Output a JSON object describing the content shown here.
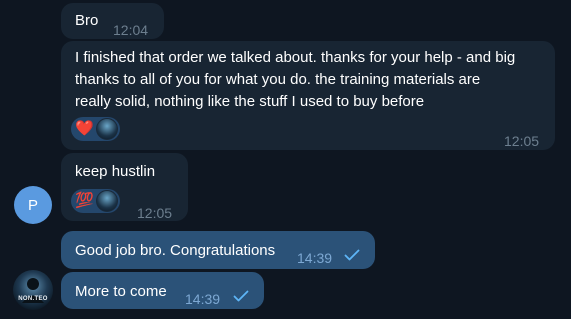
{
  "messages": [
    {
      "text": "Bro",
      "time": "12:04"
    },
    {
      "lines": [
        "I finished that order we talked about. thanks for your help - and big",
        "thanks to all of you for what you do. the training materials are",
        "really solid, nothing like the stuff I used to buy before"
      ],
      "time": "12:05",
      "reactions": [
        {
          "emoji": "❤️"
        }
      ]
    },
    {
      "text": "keep hustlin",
      "time": "12:05",
      "reactions": [
        {
          "emoji": "💯"
        }
      ]
    },
    {
      "text": "Good job bro. Congratulations",
      "time": "14:39",
      "status": "sent"
    },
    {
      "text": "More to come",
      "time": "14:39",
      "status": "sent"
    }
  ],
  "avatars": {
    "contact_initial": "P",
    "contact_color": "#5a9ae0",
    "self_label": "NON.TEO"
  },
  "colors": {
    "background": "#0e1621",
    "incoming_bubble": "#182533",
    "outgoing_bubble": "#2b5278",
    "check": "#5eb5f7"
  }
}
